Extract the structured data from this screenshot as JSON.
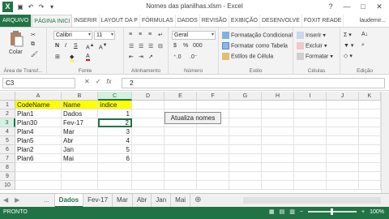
{
  "window": {
    "title": "Nomes das planilhas.xlsm - Excel",
    "app_icon": "X",
    "controls": [
      "?",
      "—",
      "□",
      "✕"
    ]
  },
  "tabs": [
    "ARQUIVO",
    "PÁGINA INICI",
    "INSERIR",
    "LAYOUT DA P",
    "FÓRMULAS",
    "DADOS",
    "REVISÃO",
    "EXIBIÇÃO",
    "DESENVOLVE",
    "FOXIT READE"
  ],
  "active_tab": "PÁGINA INICI",
  "user": "laudemir...",
  "ribbon": {
    "clipboard": {
      "paste": "Colar",
      "label": "Área de Transf..."
    },
    "font": {
      "name": "Calibri",
      "size": "11",
      "label": "Fonte"
    },
    "alignment": {
      "label": "Alinhamento"
    },
    "number": {
      "format": "Geral",
      "label": "Número"
    },
    "styles": {
      "conditional": "Formatação Condicional",
      "table": "Formatar como Tabela",
      "cell_styles": "Estilos de Célula",
      "label": "Estilo"
    },
    "cells": {
      "insert": "Inserir",
      "delete": "Excluir",
      "format": "Formatar",
      "label": "Células"
    },
    "editing": {
      "label": "Edição"
    }
  },
  "formula_bar": {
    "name_box": "C3",
    "value": "2"
  },
  "columns": [
    "A",
    "B",
    "C",
    "D",
    "E",
    "F",
    "G",
    "H",
    "I",
    "J",
    "K"
  ],
  "rows": [
    "1",
    "2",
    "3",
    "4",
    "5",
    "6",
    "7",
    "8",
    "9",
    "10"
  ],
  "table": {
    "headers": [
      "CodeName",
      "Name",
      "índice"
    ],
    "rows": [
      [
        "Plan1",
        "Dados",
        "1"
      ],
      [
        "Plan30",
        "Fev-17",
        "2"
      ],
      [
        "Plan4",
        "Mar",
        "3"
      ],
      [
        "Plan5",
        "Abr",
        "4"
      ],
      [
        "Plan2",
        "Jan",
        "5"
      ],
      [
        "Plan6",
        "Mai",
        "6"
      ]
    ]
  },
  "macro_button": "Atualiza nomes",
  "sheets": [
    "Dados",
    "Fev-17",
    "Mar",
    "Abr",
    "Jan",
    "Mai"
  ],
  "active_sheet": "Dados",
  "status": {
    "ready": "PRONTO",
    "zoom": "100%"
  },
  "colors": {
    "excel_green": "#217346",
    "header_fill": "#ffff00"
  }
}
